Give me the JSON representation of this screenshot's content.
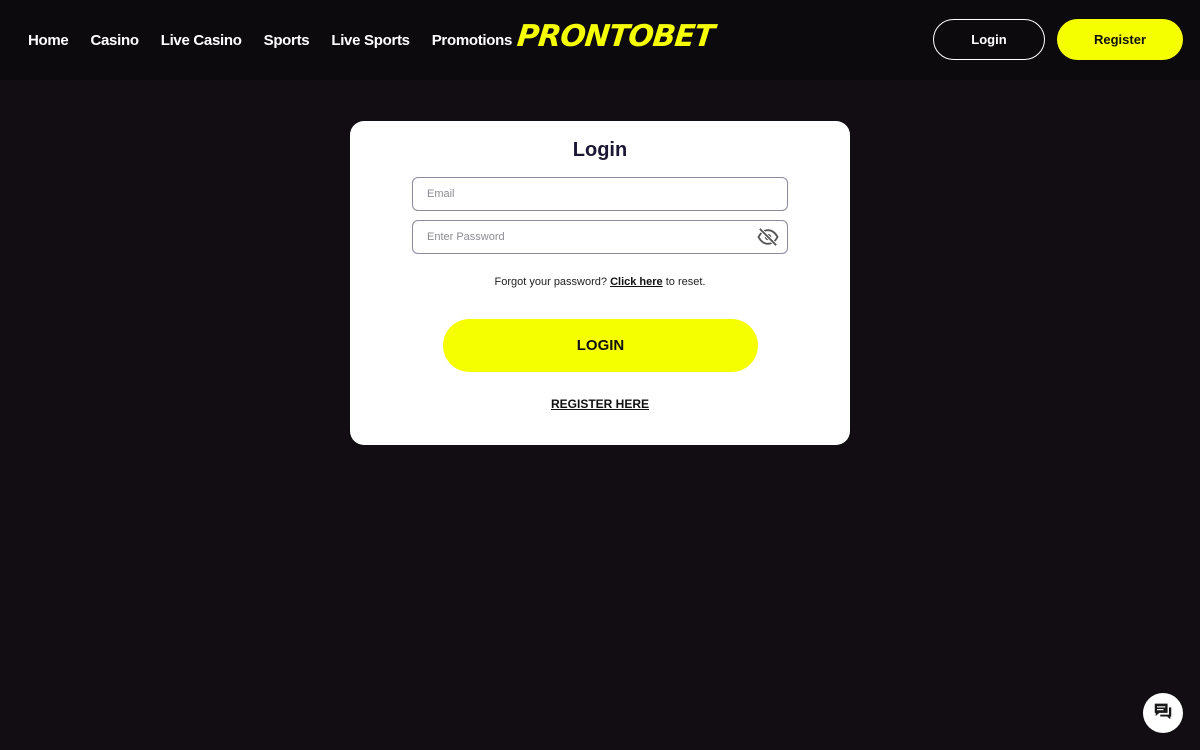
{
  "header": {
    "nav": [
      "Home",
      "Casino",
      "Live Casino",
      "Sports",
      "Live Sports",
      "Promotions"
    ],
    "logo_text": "PRONTOBET",
    "login_label": "Login",
    "register_label": "Register"
  },
  "login_form": {
    "title": "Login",
    "email_placeholder": "Email",
    "password_placeholder": "Enter Password",
    "password_toggle_icon": "eye-off-icon",
    "forgot_prefix": "Forgot your password?",
    "forgot_link": "Click here",
    "forgot_suffix": "to reset.",
    "submit_label": "LOGIN",
    "register_link": "REGISTER HERE"
  },
  "chat": {
    "icon": "chat-icon"
  },
  "colors": {
    "background": "#110d12",
    "header": "#0d0a0e",
    "accent": "#f6ff00",
    "card": "#ffffff"
  }
}
